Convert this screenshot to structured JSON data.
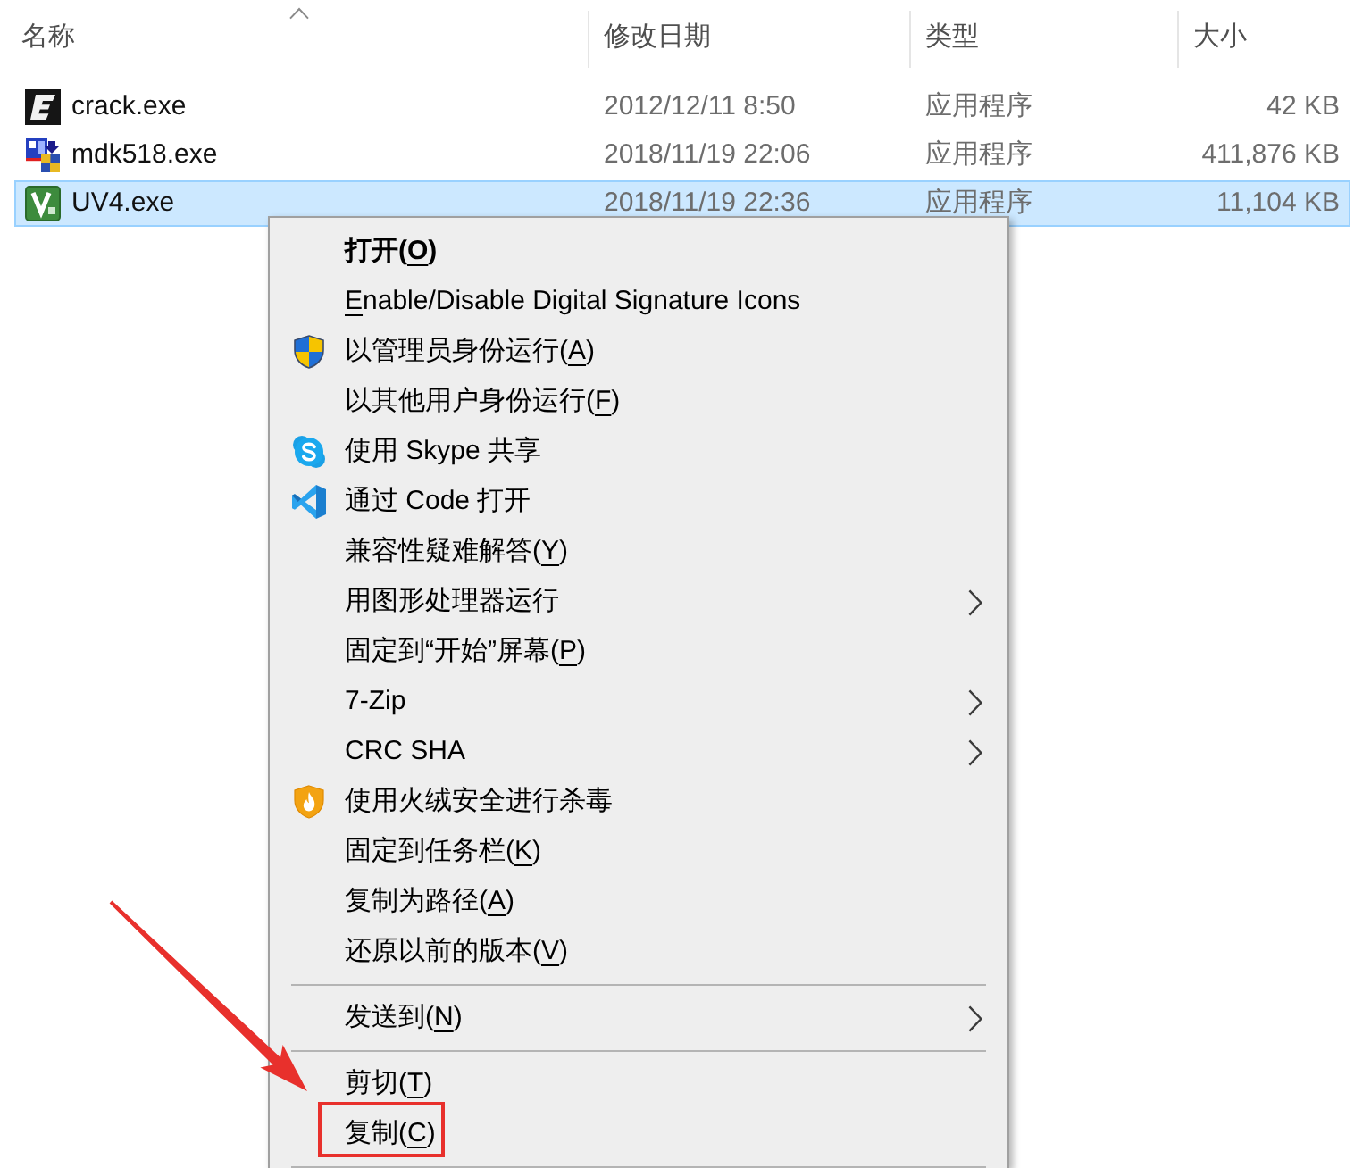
{
  "file_list": {
    "columns": [
      {
        "label": "名称",
        "sorted": true
      },
      {
        "label": "修改日期",
        "sorted": false
      },
      {
        "label": "类型",
        "sorted": false
      },
      {
        "label": "大小",
        "sorted": false
      }
    ],
    "files": [
      {
        "kind": "dark",
        "name": "crack.exe",
        "modified": "2012/12/11 8:50",
        "type": "应用程序",
        "size": "42 KB",
        "selected": false
      },
      {
        "kind": "installer",
        "name": "mdk518.exe",
        "modified": "2018/11/19 22:06",
        "type": "应用程序",
        "size": "411,876 KB",
        "selected": false
      },
      {
        "kind": "green",
        "name": "UV4.exe",
        "modified": "2018/11/19 22:36",
        "type": "应用程序",
        "size": "11,104 KB",
        "selected": true
      }
    ]
  },
  "context_menu": {
    "sections": [
      {
        "items": [
          {
            "kind": "text",
            "text": "打开(",
            "mnemonic": "O",
            "text_end": ")",
            "default": true,
            "submenu": false,
            "marked": false
          },
          {
            "kind": "text",
            "mnemonic": "E",
            "text_end": "nable/Disable Digital Signature Icons",
            "default": false,
            "submenu": false,
            "marked": false
          },
          {
            "kind": "shield",
            "text": "以管理员身份运行(",
            "mnemonic": "A",
            "text_end": ")",
            "default": false,
            "submenu": false,
            "marked": false
          },
          {
            "kind": "text",
            "text": "以其他用户身份运行(",
            "mnemonic": "F",
            "text_end": ")",
            "default": false,
            "submenu": false,
            "marked": false
          },
          {
            "kind": "sbadge",
            "text": "使用 Skype 共享",
            "default": false,
            "submenu": false,
            "marked": false
          },
          {
            "kind": "ribbon",
            "text": "通过 Code 打开",
            "default": false,
            "submenu": false,
            "marked": false
          },
          {
            "kind": "text",
            "text": "兼容性疑难解答(",
            "mnemonic": "Y",
            "text_end": ")",
            "default": false,
            "submenu": false,
            "marked": false
          },
          {
            "kind": "text",
            "text": "用图形处理器运行",
            "default": false,
            "submenu": true,
            "marked": false
          },
          {
            "kind": "text",
            "text": "固定到“开始”屏幕(",
            "mnemonic": "P",
            "text_end": ")",
            "default": false,
            "submenu": false,
            "marked": false
          },
          {
            "kind": "text",
            "text": "7-Zip",
            "default": false,
            "submenu": true,
            "marked": false
          },
          {
            "kind": "text",
            "text": "CRC SHA",
            "default": false,
            "submenu": true,
            "marked": false
          },
          {
            "kind": "flame",
            "text": "使用火绒安全进行杀毒",
            "default": false,
            "submenu": false,
            "marked": false
          },
          {
            "kind": "text",
            "text": "固定到任务栏(",
            "mnemonic": "K",
            "text_end": ")",
            "default": false,
            "submenu": false,
            "marked": false
          },
          {
            "kind": "text",
            "text": "复制为路径(",
            "mnemonic": "A",
            "text_end": ")",
            "default": false,
            "submenu": false,
            "marked": false
          },
          {
            "kind": "text",
            "text": "还原以前的版本(",
            "mnemonic": "V",
            "text_end": ")",
            "default": false,
            "submenu": false,
            "marked": false
          }
        ]
      },
      {
        "items": [
          {
            "kind": "text",
            "text": "发送到(",
            "mnemonic": "N",
            "text_end": ")",
            "default": false,
            "submenu": true,
            "marked": false
          }
        ]
      },
      {
        "items": [
          {
            "kind": "text",
            "text": "剪切(",
            "mnemonic": "T",
            "text_end": ")",
            "default": false,
            "submenu": false,
            "marked": false
          },
          {
            "kind": "text",
            "text": "复制(",
            "mnemonic": "C",
            "text_end": ")",
            "default": false,
            "submenu": false,
            "marked": true
          }
        ]
      }
    ]
  }
}
